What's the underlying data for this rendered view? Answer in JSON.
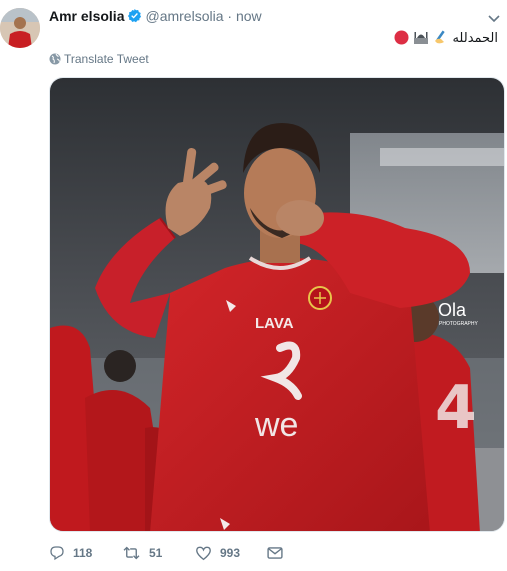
{
  "tweet": {
    "display_name": "Amr elsolia",
    "handle": "@amrelsolia",
    "separator": "·",
    "time": "now",
    "text": "الحمدلله",
    "translate_label": "Translate Tweet"
  },
  "media": {
    "photo_credit": "Ola",
    "photo_credit_sub": "PHOTOGRAPHY",
    "sponsor_text": "we",
    "kit_text": "LAVA",
    "back_number": "4"
  },
  "actions": {
    "reply_count": "118",
    "retweet_count": "51",
    "like_count": "993"
  },
  "icons": {
    "verified": "verified-badge-icon",
    "chevron": "chevron-down-icon",
    "globe": "globe-icon",
    "reply": "reply-icon",
    "retweet": "retweet-icon",
    "like": "heart-icon",
    "dm": "envelope-icon"
  },
  "colors": {
    "accent": "#1da1f2",
    "muted": "#657786",
    "jersey_red": "#c81e22"
  }
}
